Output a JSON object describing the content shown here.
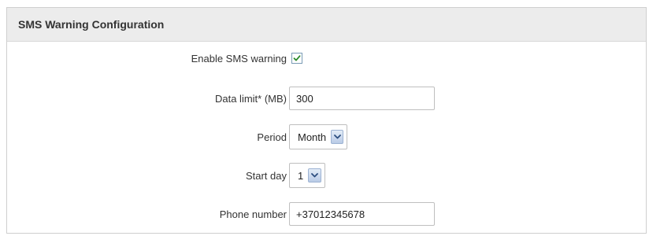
{
  "panel": {
    "title": "SMS Warning Configuration"
  },
  "form": {
    "enable_sms_warning": {
      "label": "Enable SMS warning",
      "checked": true,
      "icon": "checkmark-icon",
      "check_color": "#2a8a2a"
    },
    "data_limit": {
      "label": "Data limit* (MB)",
      "value": "300"
    },
    "period": {
      "label": "Period",
      "selected": "Month",
      "icon": "chevron-down-icon"
    },
    "start_day": {
      "label": "Start day",
      "selected": "1",
      "icon": "chevron-down-icon"
    },
    "phone_number": {
      "label": "Phone number",
      "value": "+37012345678"
    }
  }
}
